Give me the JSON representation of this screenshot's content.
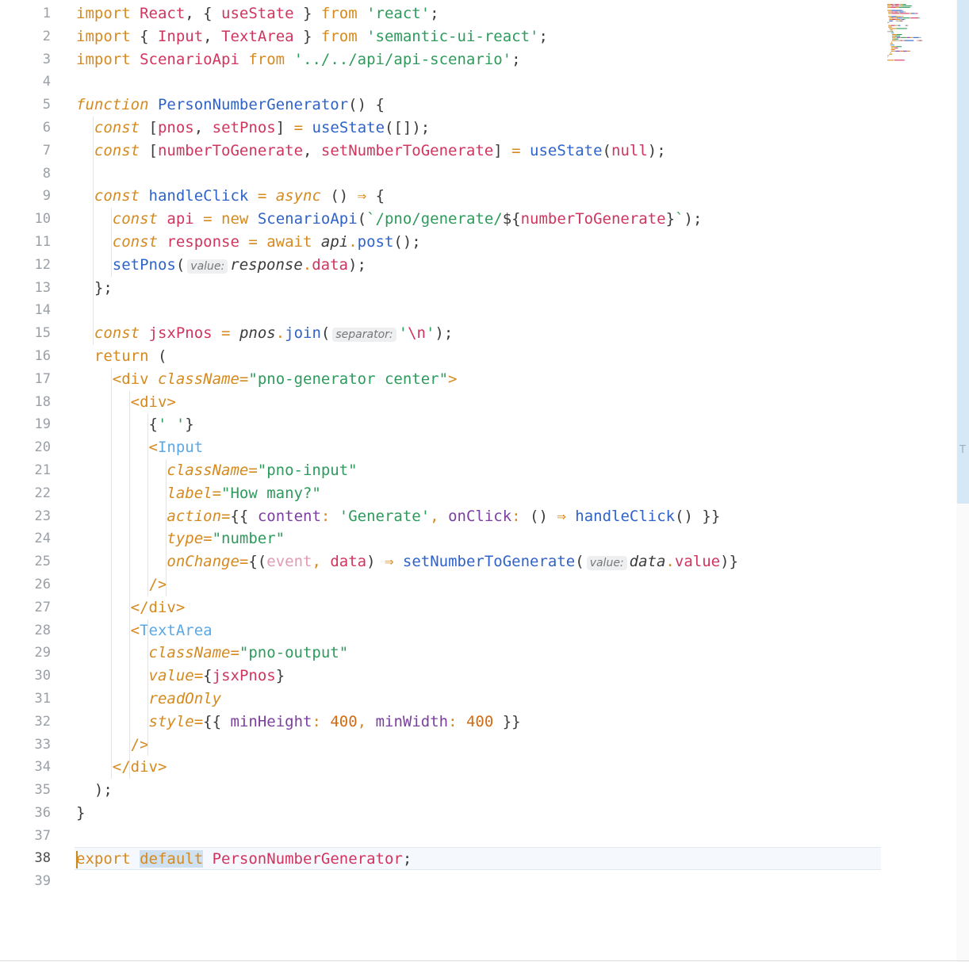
{
  "editor": {
    "file_language": "javascript-react",
    "current_line": 38,
    "lines": [
      [
        [
          "kw",
          "import "
        ],
        [
          "cls",
          "React"
        ],
        [
          "plain",
          ", { "
        ],
        [
          "var",
          "useState"
        ],
        [
          "plain",
          " } "
        ],
        [
          "kw",
          "from "
        ],
        [
          "str",
          "'react'"
        ],
        [
          "plain",
          ";"
        ]
      ],
      [
        [
          "kw",
          "import "
        ],
        [
          "plain",
          "{ "
        ],
        [
          "var",
          "Input"
        ],
        [
          "plain",
          ", "
        ],
        [
          "var",
          "TextArea"
        ],
        [
          "plain",
          " } "
        ],
        [
          "kw",
          "from "
        ],
        [
          "str",
          "'semantic-ui-react'"
        ],
        [
          "plain",
          ";"
        ]
      ],
      [
        [
          "kw",
          "import "
        ],
        [
          "cls",
          "ScenarioApi"
        ],
        [
          "kw",
          " from "
        ],
        [
          "str",
          "'../../api/api-scenario'"
        ],
        [
          "plain",
          ";"
        ]
      ],
      [],
      [
        [
          "kw it",
          "function "
        ],
        [
          "fn",
          "PersonNumberGenerator"
        ],
        [
          "plain",
          "() {"
        ]
      ],
      [
        [
          "plain",
          "  "
        ],
        [
          "kw it",
          "const "
        ],
        [
          "plain",
          "["
        ],
        [
          "var",
          "pnos"
        ],
        [
          "plain",
          ", "
        ],
        [
          "var",
          "setPnos"
        ],
        [
          "plain",
          "] "
        ],
        [
          "kw",
          "= "
        ],
        [
          "fn",
          "useState"
        ],
        [
          "plain",
          "([]);"
        ]
      ],
      [
        [
          "plain",
          "  "
        ],
        [
          "kw it",
          "const "
        ],
        [
          "plain",
          "["
        ],
        [
          "var",
          "numberToGenerate"
        ],
        [
          "plain",
          ", "
        ],
        [
          "var",
          "setNumberToGenerate"
        ],
        [
          "plain",
          "] "
        ],
        [
          "kw",
          "= "
        ],
        [
          "fn",
          "useState"
        ],
        [
          "plain",
          "("
        ],
        [
          "var",
          "null"
        ],
        [
          "plain",
          ");"
        ]
      ],
      [],
      [
        [
          "plain",
          "  "
        ],
        [
          "kw it",
          "const "
        ],
        [
          "fn",
          "handleClick"
        ],
        [
          "kw",
          " = "
        ],
        [
          "kw it",
          "async "
        ],
        [
          "plain",
          "() "
        ],
        [
          "kw",
          "⇒ "
        ],
        [
          "plain",
          "{"
        ]
      ],
      [
        [
          "plain",
          "    "
        ],
        [
          "kw it",
          "const "
        ],
        [
          "var",
          "api"
        ],
        [
          "kw",
          " = new "
        ],
        [
          "fn",
          "ScenarioApi"
        ],
        [
          "plain",
          "("
        ],
        [
          "str",
          "`/pno/generate/"
        ],
        [
          "plain",
          "${"
        ],
        [
          "var",
          "numberToGenerate"
        ],
        [
          "plain",
          "}"
        ],
        [
          "str",
          "`"
        ],
        [
          "plain",
          ");"
        ]
      ],
      [
        [
          "plain",
          "    "
        ],
        [
          "kw it",
          "const "
        ],
        [
          "var",
          "response"
        ],
        [
          "kw",
          " = await "
        ],
        [
          "objv",
          "api"
        ],
        [
          "kw",
          "."
        ],
        [
          "fn",
          "post"
        ],
        [
          "plain",
          "();"
        ]
      ],
      [
        [
          "plain",
          "    "
        ],
        [
          "fn",
          "setPnos"
        ],
        [
          "plain",
          "("
        ],
        [
          "hint",
          "value:"
        ],
        [
          "objv",
          "response"
        ],
        [
          "kw",
          "."
        ],
        [
          "var",
          "data"
        ],
        [
          "plain",
          ");"
        ]
      ],
      [
        [
          "plain",
          "  };"
        ]
      ],
      [],
      [
        [
          "plain",
          "  "
        ],
        [
          "kw it",
          "const "
        ],
        [
          "var",
          "jsxPnos"
        ],
        [
          "kw",
          " = "
        ],
        [
          "objv",
          "pnos"
        ],
        [
          "kw",
          "."
        ],
        [
          "fn",
          "join"
        ],
        [
          "plain",
          "("
        ],
        [
          "hint",
          "separator:"
        ],
        [
          "str",
          "'"
        ],
        [
          "var",
          "\\n"
        ],
        [
          "str",
          "'"
        ],
        [
          "plain",
          ");"
        ]
      ],
      [
        [
          "plain",
          "  "
        ],
        [
          "kw",
          "return "
        ],
        [
          "plain",
          "("
        ]
      ],
      [
        [
          "plain",
          "    "
        ],
        [
          "tag",
          "<div "
        ],
        [
          "attr",
          "className"
        ],
        [
          "kw",
          "="
        ],
        [
          "str",
          "\"pno-generator center\""
        ],
        [
          "tag",
          ">"
        ]
      ],
      [
        [
          "plain",
          "      "
        ],
        [
          "tag",
          "<div>"
        ]
      ],
      [
        [
          "plain",
          "        {"
        ],
        [
          "str",
          "' '"
        ],
        [
          "plain",
          "}"
        ]
      ],
      [
        [
          "plain",
          "        "
        ],
        [
          "tag",
          "<"
        ],
        [
          "comp",
          "Input"
        ]
      ],
      [
        [
          "plain",
          "          "
        ],
        [
          "attr",
          "className"
        ],
        [
          "kw",
          "="
        ],
        [
          "str",
          "\"pno-input\""
        ]
      ],
      [
        [
          "plain",
          "          "
        ],
        [
          "attr",
          "label"
        ],
        [
          "kw",
          "="
        ],
        [
          "str",
          "\"How many?\""
        ]
      ],
      [
        [
          "plain",
          "          "
        ],
        [
          "attr",
          "action"
        ],
        [
          "kw",
          "="
        ],
        [
          "plain",
          "{{ "
        ],
        [
          "prop",
          "content"
        ],
        [
          "kw",
          ": "
        ],
        [
          "str",
          "'Generate'"
        ],
        [
          "kw",
          ", "
        ],
        [
          "prop",
          "onClick"
        ],
        [
          "kw",
          ": "
        ],
        [
          "plain",
          "() "
        ],
        [
          "kw",
          "⇒ "
        ],
        [
          "fn",
          "handleClick"
        ],
        [
          "plain",
          "() }}"
        ]
      ],
      [
        [
          "plain",
          "          "
        ],
        [
          "attr",
          "type"
        ],
        [
          "kw",
          "="
        ],
        [
          "str",
          "\"number\""
        ]
      ],
      [
        [
          "plain",
          "          "
        ],
        [
          "attr",
          "onChange"
        ],
        [
          "kw",
          "="
        ],
        [
          "plain",
          "{("
        ],
        [
          "param",
          "event"
        ],
        [
          "kw",
          ", "
        ],
        [
          "var",
          "data"
        ],
        [
          "plain",
          ") "
        ],
        [
          "kw",
          "⇒ "
        ],
        [
          "fn",
          "setNumberToGenerate"
        ],
        [
          "plain",
          "("
        ],
        [
          "hint",
          "value:"
        ],
        [
          "objv",
          "data"
        ],
        [
          "kw",
          "."
        ],
        [
          "var",
          "value"
        ],
        [
          "plain",
          ")}"
        ]
      ],
      [
        [
          "plain",
          "        "
        ],
        [
          "tag",
          "/>"
        ]
      ],
      [
        [
          "plain",
          "      "
        ],
        [
          "tag",
          "</div>"
        ]
      ],
      [
        [
          "plain",
          "      "
        ],
        [
          "tag",
          "<"
        ],
        [
          "comp",
          "TextArea"
        ]
      ],
      [
        [
          "plain",
          "        "
        ],
        [
          "attr",
          "className"
        ],
        [
          "kw",
          "="
        ],
        [
          "str",
          "\"pno-output\""
        ]
      ],
      [
        [
          "plain",
          "        "
        ],
        [
          "attr",
          "value"
        ],
        [
          "kw",
          "="
        ],
        [
          "plain",
          "{"
        ],
        [
          "var",
          "jsxPnos"
        ],
        [
          "plain",
          "}"
        ]
      ],
      [
        [
          "plain",
          "        "
        ],
        [
          "attr",
          "readOnly"
        ]
      ],
      [
        [
          "plain",
          "        "
        ],
        [
          "attr",
          "style"
        ],
        [
          "kw",
          "="
        ],
        [
          "plain",
          "{{ "
        ],
        [
          "prop",
          "minHeight"
        ],
        [
          "kw",
          ": "
        ],
        [
          "num",
          "400"
        ],
        [
          "kw",
          ", "
        ],
        [
          "prop",
          "minWidth"
        ],
        [
          "kw",
          ": "
        ],
        [
          "num",
          "400"
        ],
        [
          "plain",
          " }}"
        ]
      ],
      [
        [
          "plain",
          "      "
        ],
        [
          "tag",
          "/>"
        ]
      ],
      [
        [
          "plain",
          "    "
        ],
        [
          "tag",
          "</div>"
        ]
      ],
      [
        [
          "plain",
          "  );"
        ]
      ],
      [
        [
          "plain",
          "}"
        ]
      ],
      [],
      [
        [
          "caret",
          ""
        ],
        [
          "kw",
          "export "
        ],
        [
          "kw hl",
          "default"
        ],
        [
          "plain",
          " "
        ],
        [
          "var",
          "PersonNumberGenerator"
        ],
        [
          "plain",
          ";"
        ]
      ],
      []
    ]
  },
  "colors": {
    "keyword": "#d58a1f",
    "function": "#2f63c9",
    "variable": "#d0355f",
    "string": "#2e9a5c",
    "component": "#5aa8e6",
    "property": "#7b3fa0",
    "number": "#d36b12",
    "line_number": "#9aa0a6",
    "scroll_thumb": "#d6e7f6"
  },
  "minimap": {
    "icon": "code-minimap"
  },
  "scrollbar": {
    "marker": "T"
  }
}
